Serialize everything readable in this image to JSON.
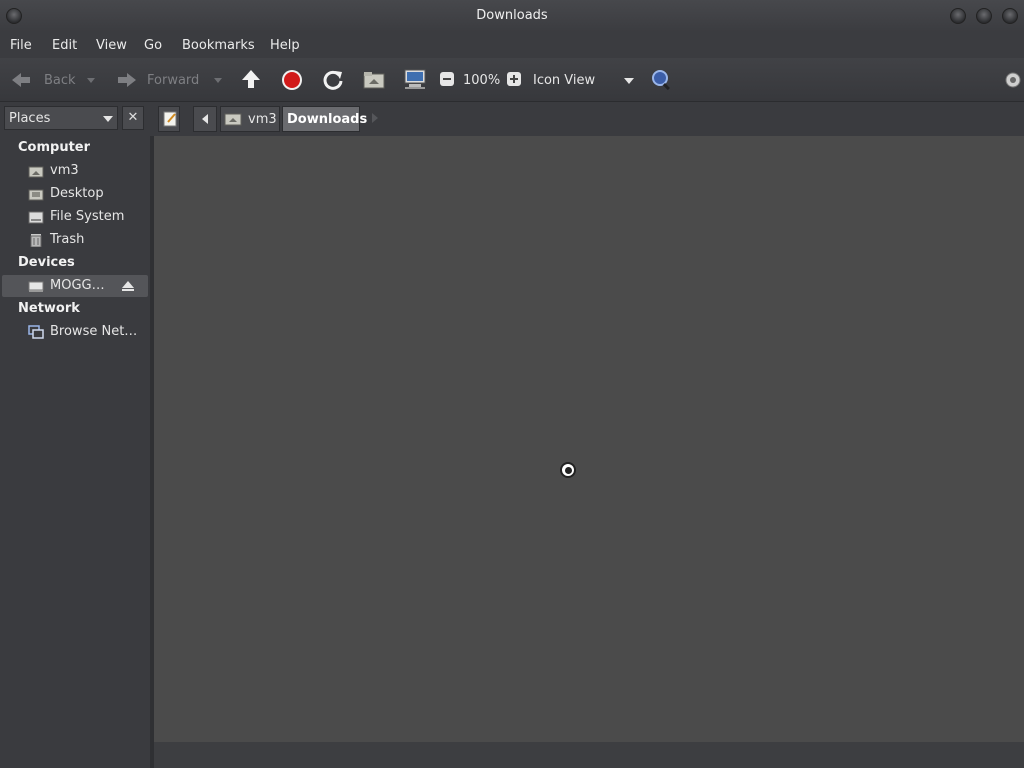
{
  "window": {
    "title": "Downloads"
  },
  "menu": [
    "File",
    "Edit",
    "View",
    "Go",
    "Bookmarks",
    "Help"
  ],
  "toolbar": {
    "back_label": "Back",
    "forward_label": "Forward",
    "zoom_level": "100%",
    "view_mode": "Icon View"
  },
  "side_pane": {
    "selector_label": "Places",
    "close_glyph": "✕"
  },
  "breadcrumb": {
    "items": [
      "vm3",
      "Downloads"
    ]
  },
  "sidebar": {
    "computer_header": "Computer",
    "computer_items": [
      "vm3",
      "Desktop",
      "File System",
      "Trash"
    ],
    "devices_header": "Devices",
    "devices_items": [
      "MOGG…"
    ],
    "network_header": "Network",
    "network_items": [
      "Browse Net…"
    ]
  },
  "colors": {
    "content_bg": "#4b4b4b",
    "sidebar_bg": "#3a3b3f",
    "stop_red": "#d11a1a",
    "accent_blue": "#5a8fd6"
  }
}
